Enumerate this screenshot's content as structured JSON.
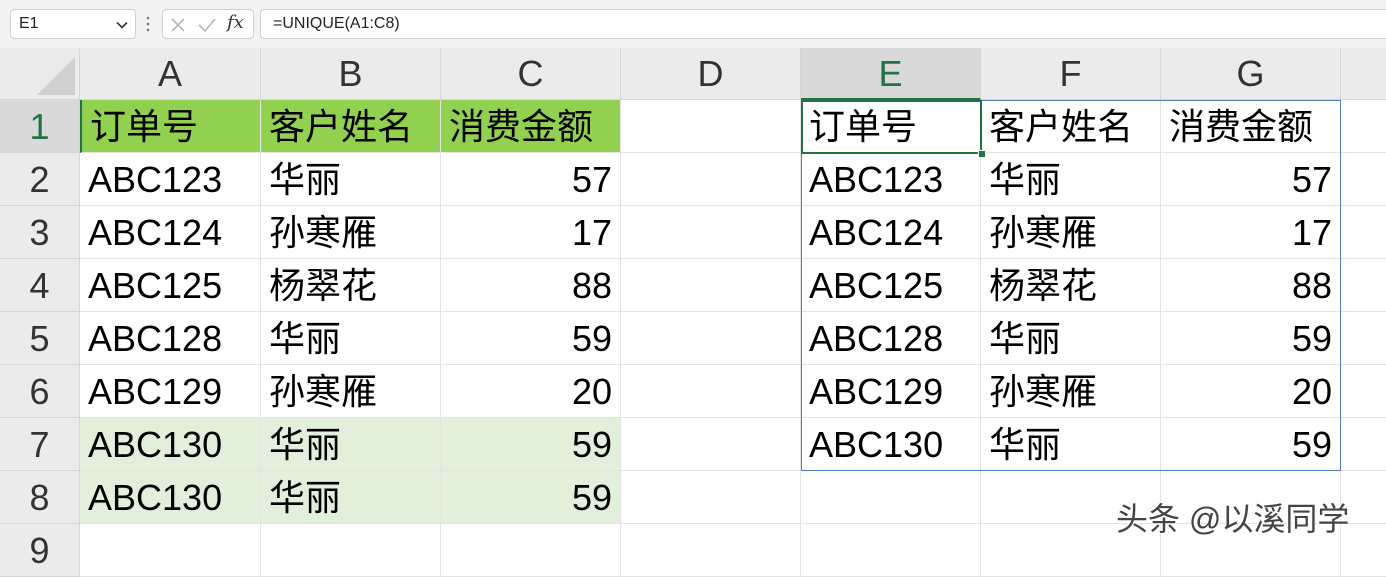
{
  "name_box": {
    "value": "E1"
  },
  "formula_bar": {
    "fx": "fx",
    "formula": "=UNIQUE(A1:C8)"
  },
  "columns": [
    "A",
    "B",
    "C",
    "D",
    "E",
    "F",
    "G"
  ],
  "rows": [
    "1",
    "2",
    "3",
    "4",
    "5",
    "6",
    "7",
    "8",
    "9"
  ],
  "source_table": {
    "header": [
      "订单号",
      "客户姓名",
      "消费金额"
    ],
    "rows": [
      [
        "ABC123",
        "华丽",
        "57"
      ],
      [
        "ABC124",
        "孙寒雁",
        "17"
      ],
      [
        "ABC125",
        "杨翠花",
        "88"
      ],
      [
        "ABC128",
        "华丽",
        "59"
      ],
      [
        "ABC129",
        "孙寒雁",
        "20"
      ],
      [
        "ABC130",
        "华丽",
        "59"
      ],
      [
        "ABC130",
        "华丽",
        "59"
      ]
    ]
  },
  "result_table": {
    "header": [
      "订单号",
      "客户姓名",
      "消费金额"
    ],
    "rows": [
      [
        "ABC123",
        "华丽",
        "57"
      ],
      [
        "ABC124",
        "孙寒雁",
        "17"
      ],
      [
        "ABC125",
        "杨翠花",
        "88"
      ],
      [
        "ABC128",
        "华丽",
        "59"
      ],
      [
        "ABC129",
        "孙寒雁",
        "20"
      ],
      [
        "ABC130",
        "华丽",
        "59"
      ]
    ]
  },
  "watermark": "头条 @以溪同学",
  "colors": {
    "header_fill": "#92d050",
    "duplicate_fill": "#e2efda",
    "selection": "#217346",
    "spill_border": "#4f7fc1"
  }
}
